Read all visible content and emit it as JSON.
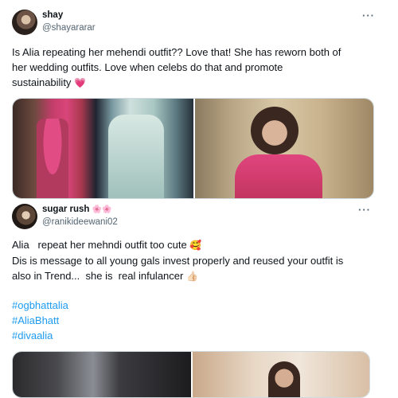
{
  "tweets": [
    {
      "display_name": "shay",
      "handle": "@shayararar",
      "more_label": "···",
      "text_lines": [
        "Is Alia repeating her mehendi outfit?? Love that! She has reworn both of",
        "her wedding outfits. Love when celebs do that and promote",
        "sustainability"
      ],
      "emoji": "💗"
    },
    {
      "display_name": "sugar rush",
      "name_emoji": "🌸🌸",
      "handle": "@ranikideewani02",
      "more_label": "···",
      "text_lines": [
        "Alia   repeat her mehndi outfit too cute",
        "Dis is message to all young gals invest properly and reused your outfit is",
        "also in Trend...  she is  real infulancer"
      ],
      "emoji_line1": "🥰",
      "emoji_line3": "👍🏻",
      "hashtags": [
        "#ogbhattalia",
        "#AliaBhatt",
        "#divaalia"
      ]
    }
  ],
  "colors": {
    "accent": "#1d9bf0",
    "text": "#0f1419",
    "secondary": "#536471",
    "border": "#cfd9de"
  }
}
